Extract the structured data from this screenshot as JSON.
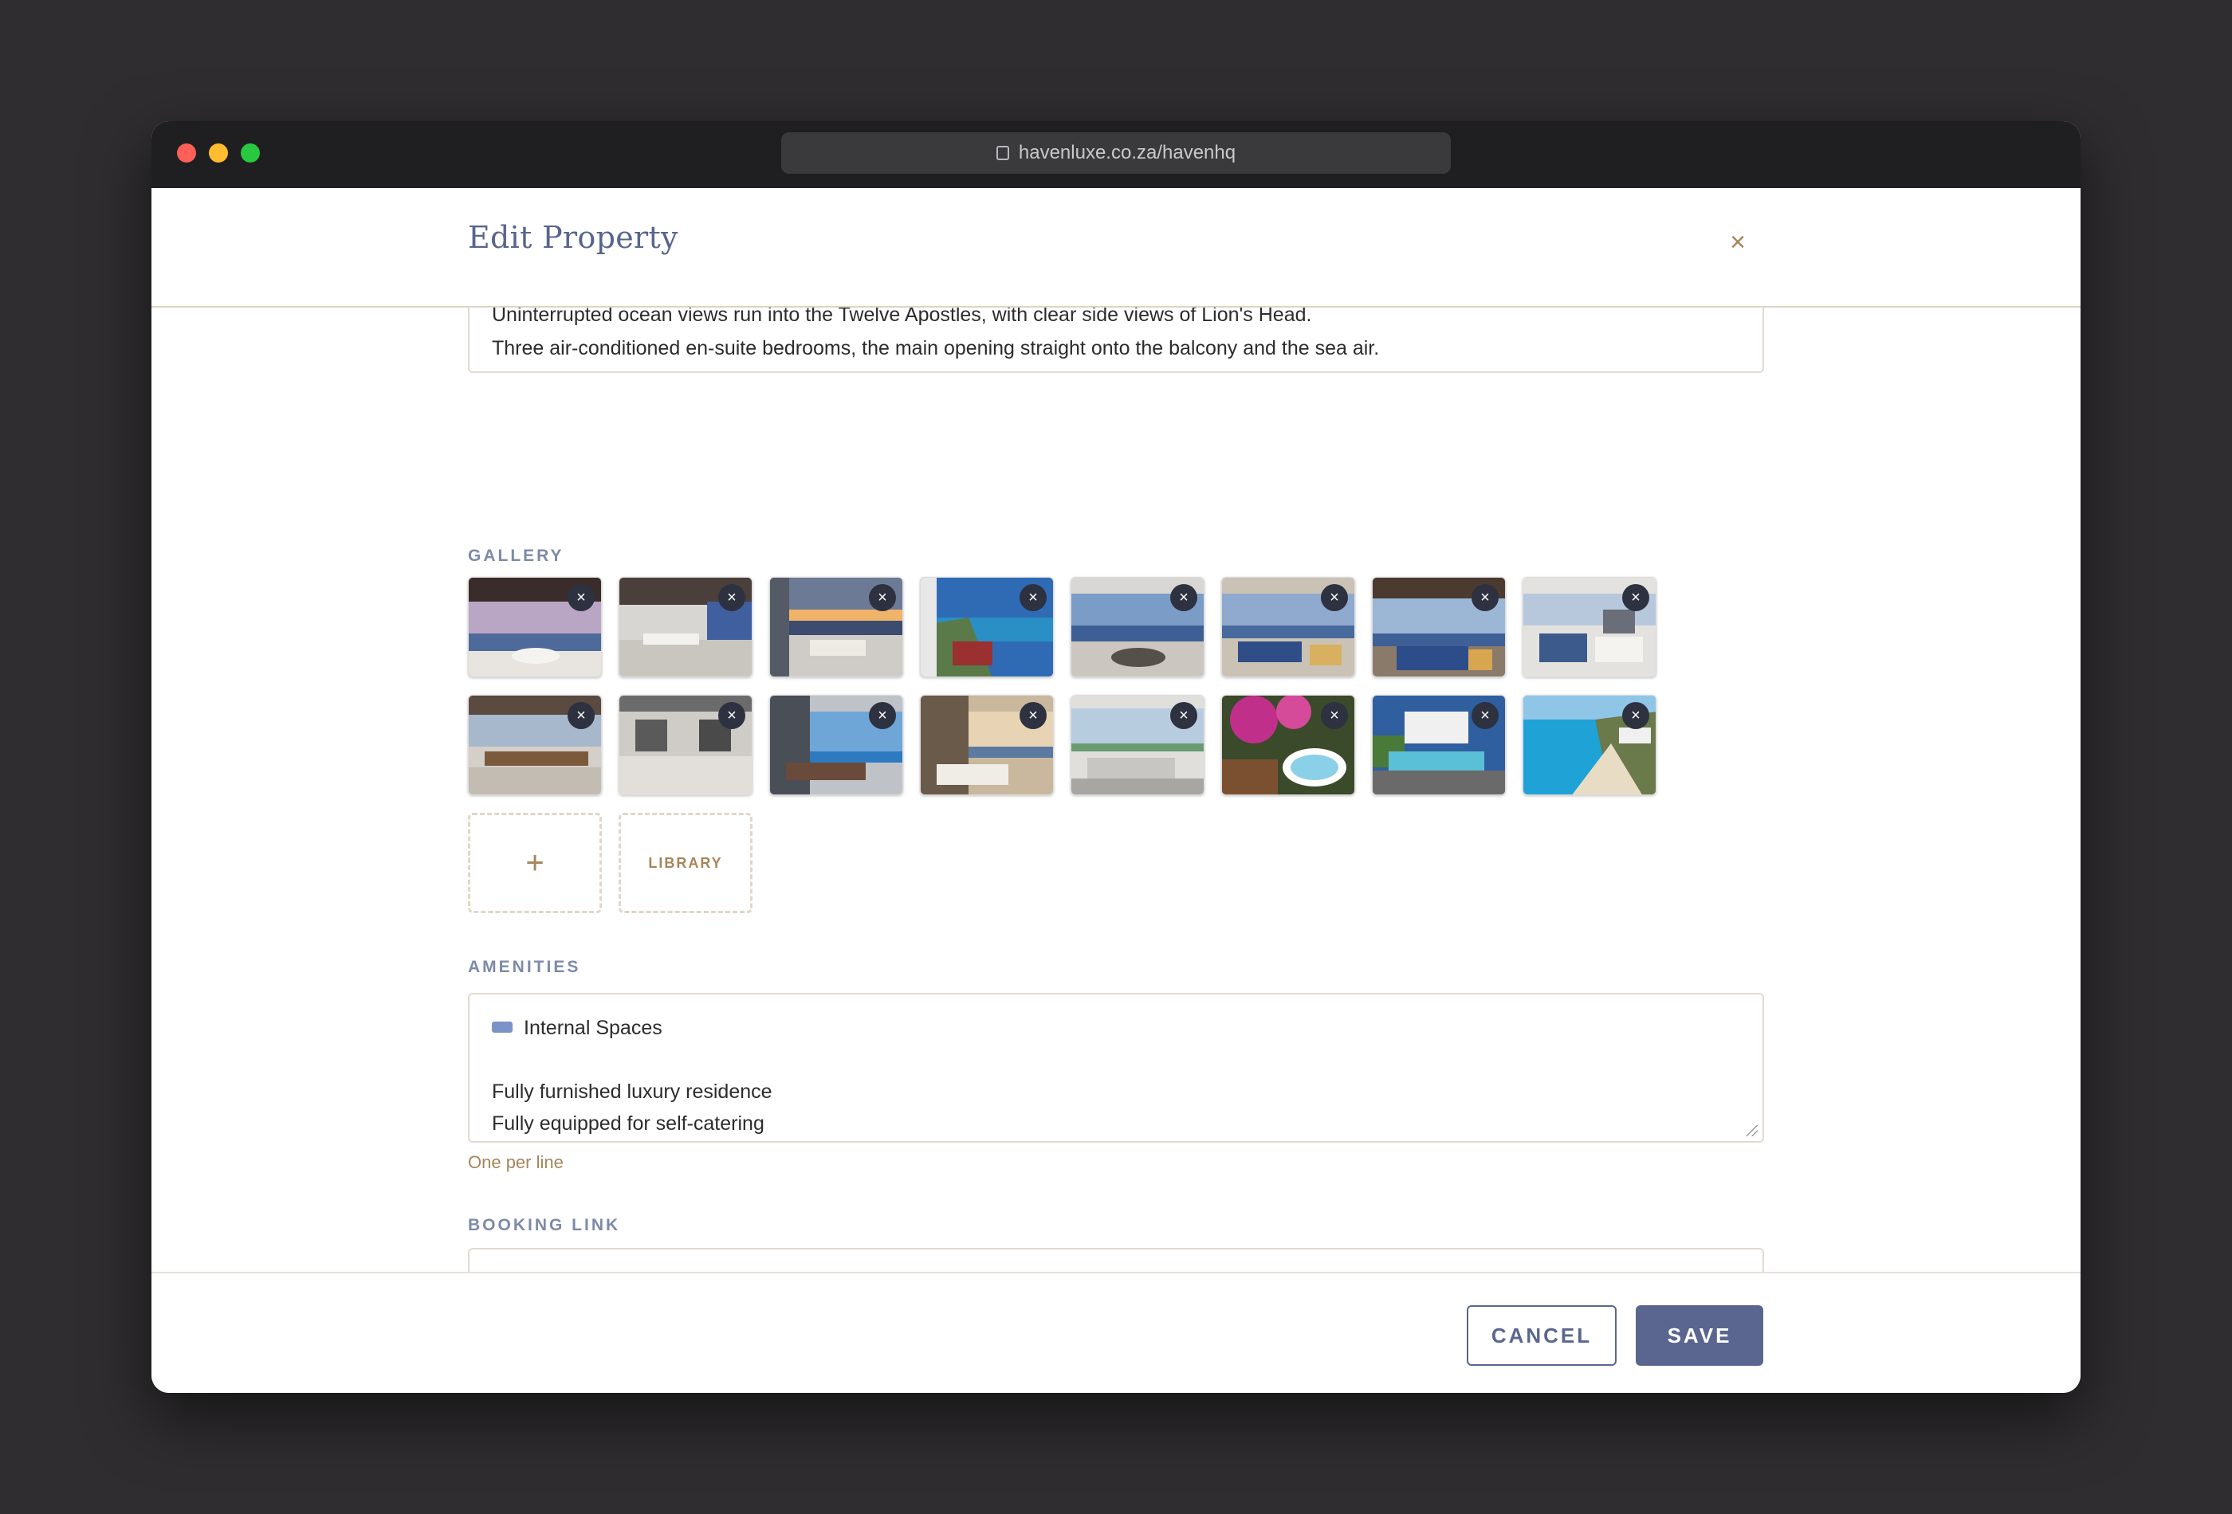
{
  "browser": {
    "url": "havenluxe.co.za/havenhq"
  },
  "modal": {
    "title": "Edit Property",
    "close_label": "×"
  },
  "description": {
    "lines": [
      "Uninterrupted ocean views run into the Twelve Apostles, with clear side views of Lion's Head.",
      "Three air-conditioned en-suite bedrooms, the main opening straight onto the balcony and the sea air."
    ]
  },
  "gallery": {
    "label": "GALLERY",
    "remove_label": "×",
    "add_label": "+",
    "library_label": "LIBRARY",
    "images": [
      "living room with ocean view at dusk",
      "dining area with coastal view",
      "balcony lounge at sunset",
      "coastal road and ocean",
      "open plan lounge with sea view",
      "lounge with blue cushions",
      "lounge with ocean panorama",
      "bright living and dining area",
      "dining room with wooden table",
      "kitchen with marble floors",
      "bedroom with ocean view",
      "bedroom opening onto balcony",
      "white lounge with balcony",
      "garden hot tub with bougainvillea",
      "pool deck with villas",
      "beach and mountain coastline"
    ]
  },
  "amenities": {
    "label": "AMENITIES",
    "icon": "bed-icon",
    "lines": [
      "Internal Spaces",
      "",
      "Fully furnished luxury residence",
      "Fully equipped for self-catering"
    ],
    "hint": "One per line"
  },
  "booking": {
    "label": "BOOKING LINK",
    "value": ""
  },
  "footer": {
    "cancel_label": "CANCEL",
    "save_label": "SAVE"
  },
  "colors": {
    "accent": "#5a668f",
    "gold": "#a6855a",
    "label": "#7d8aa8"
  }
}
